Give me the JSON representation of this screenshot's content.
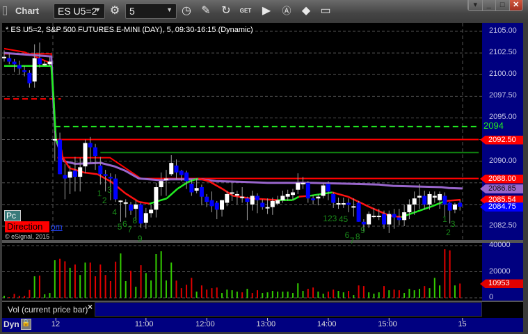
{
  "window": {
    "title": "Chart"
  },
  "toolbar": {
    "symbol": "ES U5=2",
    "interval": "5",
    "get_label": "GET"
  },
  "chart_info": "* ES U5=2, S&P 500 FUTURES E-MINI (DAY), 5, 09:30-16:15 (Dynamic)",
  "overlay": {
    "pc_label": "Pc",
    "direction_label": "Direction",
    "link_label": "om",
    "copyright": "© eSignal, 2015"
  },
  "vol_label": "Vol (current price bar)",
  "vol_close": "×",
  "bottom": {
    "dyn_label": "Dyn"
  },
  "colors": {
    "up": "#ffffff",
    "down": "#0000ff",
    "wick": "#a0a0a0",
    "vol_up": "#33cc00",
    "vol_down": "#e00000",
    "ma_up": "#22ee22",
    "ma_down": "#ff1111",
    "slow_ma": "#9966cc",
    "level_red": "#ff0000",
    "level_green": "#22ee22",
    "level_darkgreen": "#118811",
    "count": "#1a8a1a",
    "axis_bg": "#000080"
  },
  "chart_data": {
    "type": "candlestick",
    "ylim": [
      2081.5,
      2105.5
    ],
    "y_ticks": [
      "2105.00",
      "2102.50",
      "2100.00",
      "2097.50",
      "2095.00",
      "2090.00",
      "2082.50"
    ],
    "y_tick_values": [
      2105,
      2102.5,
      2100,
      2097.5,
      2095,
      2090,
      2082.5
    ],
    "x_ticks": [
      {
        "label": "12",
        "bar": 10.2
      },
      {
        "label": "11:00",
        "bar": 28
      },
      {
        "label": "12:00",
        "bar": 40
      },
      {
        "label": "13:00",
        "bar": 52
      },
      {
        "label": "14:00",
        "bar": 64
      },
      {
        "label": "15:00",
        "bar": 76
      },
      {
        "label": "15",
        "bar": 90.5
      }
    ],
    "candles": [
      [
        2102.0,
        2102.8,
        2101.5,
        2102.05
      ],
      [
        2101.9,
        2102.5,
        2101.2,
        2101.5
      ],
      [
        2101.5,
        2101.8,
        2100.3,
        2101.2
      ],
      [
        2101.1,
        2101.6,
        2100.0,
        2100.7
      ],
      [
        2100.5,
        2101.0,
        2099.8,
        2100.3
      ],
      [
        2100.2,
        2100.5,
        2098.5,
        2099.0
      ],
      [
        2099.2,
        2103.5,
        2098.5,
        2101.9
      ],
      [
        2101.9,
        2103.7,
        2100.8,
        2101.2
      ],
      [
        2101.2,
        2101.6,
        2101.0,
        2101.25
      ],
      [
        2101.2,
        2102.0,
        2101.0,
        2101.5
      ],
      [
        2092.5,
        2093.5,
        2090.0,
        2092.55
      ],
      [
        2092.5,
        2093.3,
        2088.5,
        2088.5
      ],
      [
        2088.4,
        2089.7,
        2085.6,
        2088.0
      ],
      [
        2088.1,
        2089.5,
        2086.2,
        2088.8
      ],
      [
        2088.9,
        2090.5,
        2086.5,
        2088.2
      ],
      [
        2088.2,
        2090.4,
        2086.5,
        2089.3
      ],
      [
        2089.4,
        2092.5,
        2088.6,
        2092.1
      ],
      [
        2092.1,
        2092.8,
        2089.8,
        2091.6
      ],
      [
        2091.6,
        2092.0,
        2089.0,
        2090.6
      ],
      [
        2089.5,
        2090.5,
        2087.3,
        2088.5
      ],
      [
        2088.5,
        2089.0,
        2086.5,
        2088.3
      ],
      [
        2088.2,
        2088.6,
        2085.5,
        2088.0
      ],
      [
        2088.0,
        2088.5,
        2085.3,
        2085.6
      ],
      [
        2085.4,
        2085.5,
        2083.0,
        2085.45
      ],
      [
        2085.2,
        2085.6,
        2083.5,
        2085.25
      ],
      [
        2085.0,
        2085.3,
        2083.8,
        2084.3
      ],
      [
        2084.5,
        2085.5,
        2083.2,
        2085.0
      ],
      [
        2085.0,
        2085.2,
        2082.3,
        2082.8
      ],
      [
        2082.9,
        2084.6,
        2082.2,
        2084.0
      ],
      [
        2084.0,
        2085.0,
        2083.5,
        2084.4
      ],
      [
        2084.4,
        2087.5,
        2083.5,
        2087.0
      ],
      [
        2087.0,
        2088.7,
        2086.0,
        2087.7
      ],
      [
        2087.9,
        2089.0,
        2086.0,
        2088.0
      ],
      [
        2088.5,
        2090.7,
        2088.3,
        2089.8
      ],
      [
        2089.5,
        2090.2,
        2087.9,
        2088.7
      ],
      [
        2088.9,
        2089.0,
        2087.7,
        2088.4
      ],
      [
        2088.7,
        2088.9,
        2086.8,
        2087.7
      ],
      [
        2087.4,
        2087.9,
        2086.0,
        2086.4
      ],
      [
        2086.6,
        2088.0,
        2086.3,
        2086.9
      ],
      [
        2087.0,
        2087.3,
        2084.9,
        2085.9
      ],
      [
        2085.9,
        2086.2,
        2084.7,
        2085.3
      ],
      [
        2085.5,
        2086.5,
        2084.1,
        2084.8
      ],
      [
        2085.2,
        2085.4,
        2083.3,
        2084.4
      ],
      [
        2084.4,
        2085.5,
        2083.6,
        2085.5
      ],
      [
        2085.2,
        2086.6,
        2084.8,
        2086.2
      ],
      [
        2086.35,
        2087.5,
        2085.4,
        2086.4
      ],
      [
        2086.15,
        2086.6,
        2085.0,
        2086.2
      ],
      [
        2085.85,
        2087.0,
        2085.2,
        2085.9
      ],
      [
        2085.7,
        2085.9,
        2083.2,
        2085.3
      ],
      [
        2085.0,
        2086.6,
        2084.3,
        2086.0
      ],
      [
        2086.0,
        2086.3,
        2084.0,
        2085.5
      ],
      [
        2085.2,
        2085.6,
        2084.4,
        2084.7
      ],
      [
        2084.65,
        2085.7,
        2083.9,
        2084.7
      ],
      [
        2084.7,
        2085.8,
        2083.8,
        2085.4
      ],
      [
        2085.1,
        2086.0,
        2084.9,
        2085.5
      ],
      [
        2085.5,
        2086.6,
        2085.2,
        2086.0
      ],
      [
        2085.9,
        2086.7,
        2085.4,
        2086.2
      ],
      [
        2086.1,
        2086.8,
        2085.5,
        2086.4
      ],
      [
        2086.7,
        2088.6,
        2086.2,
        2087.5
      ],
      [
        2087.45,
        2088.2,
        2086.8,
        2087.5
      ],
      [
        2087.5,
        2087.7,
        2085.2,
        2085.7
      ],
      [
        2085.7,
        2086.1,
        2085.0,
        2085.5
      ],
      [
        2085.7,
        2086.2,
        2084.9,
        2085.9
      ],
      [
        2086.0,
        2087.5,
        2085.7,
        2087.2
      ],
      [
        2087.4,
        2087.7,
        2085.5,
        2086.5
      ],
      [
        2086.2,
        2086.4,
        2084.6,
        2085.2
      ],
      [
        2085.1,
        2085.8,
        2084.5,
        2085.15
      ],
      [
        2085.1,
        2085.8,
        2084.6,
        2085.15
      ],
      [
        2085.2,
        2085.7,
        2084.1,
        2084.95
      ],
      [
        2084.75,
        2085.7,
        2083.6,
        2084.8
      ],
      [
        2085.2,
        2085.4,
        2083.0,
        2083.0
      ],
      [
        2083.0,
        2083.3,
        2081.9,
        2082.7
      ],
      [
        2082.7,
        2084.2,
        2082.3,
        2083.9
      ],
      [
        2083.65,
        2084.6,
        2083.4,
        2083.7
      ],
      [
        2083.65,
        2084.5,
        2083.2,
        2083.7
      ],
      [
        2083.9,
        2084.3,
        2082.2,
        2082.7
      ],
      [
        2082.7,
        2084.3,
        2081.7,
        2083.9
      ],
      [
        2083.9,
        2084.5,
        2082.2,
        2083.5
      ],
      [
        2083.5,
        2084.5,
        2082.6,
        2083.2
      ],
      [
        2083.2,
        2085.0,
        2082.5,
        2084.1
      ],
      [
        2084.1,
        2085.6,
        2083.3,
        2085.0
      ],
      [
        2085.0,
        2086.5,
        2083.8,
        2085.7
      ],
      [
        2085.8,
        2087.4,
        2084.5,
        2086.0
      ],
      [
        2086.0,
        2086.6,
        2084.4,
        2085.0
      ],
      [
        2085.0,
        2086.5,
        2084.4,
        2086.2
      ],
      [
        2085.8,
        2086.5,
        2085.2,
        2086.0
      ],
      [
        2085.5,
        2086.5,
        2084.5,
        2086.2
      ],
      [
        2086.0,
        2086.4,
        2083.6,
        2085.0
      ],
      [
        2085.2,
        2085.3,
        2082.8,
        2084.3
      ],
      [
        2084.4,
        2085.2,
        2084.0,
        2085.0
      ],
      [
        2085.2,
        2085.5,
        2084.3,
        2084.75
      ]
    ],
    "volume": [
      1600,
      500,
      3000,
      1600,
      1600,
      6000,
      16500,
      17000,
      2700,
      3700,
      28800,
      30000,
      28000,
      23000,
      25500,
      17500,
      27000,
      27000,
      16500,
      25500,
      17500,
      12800,
      27700,
      34000,
      12800,
      20800,
      8500,
      25000,
      19000,
      13300,
      33600,
      35700,
      13300,
      27000,
      13200,
      7400,
      10000,
      15300,
      4750,
      9500,
      6300,
      7400,
      7900,
      3700,
      6300,
      5800,
      4750,
      4200,
      6900,
      3700,
      5800,
      3700,
      4200,
      5300,
      4750,
      4750,
      4750,
      3700,
      11100,
      5300,
      6900,
      7900,
      4750,
      3200,
      4750,
      6300,
      5300,
      4200,
      5300,
      2100,
      9500,
      9000,
      4200,
      3200,
      4200,
      9000,
      5800,
      6300,
      5800,
      3700,
      6900,
      5800,
      6900,
      9000,
      7400,
      15300,
      9500,
      37300,
      36400,
      9500,
      10953
    ],
    "volume_dir": "gr rrrrgrggg rrgrggrrr rrrggrgrgg ggggrrrrgr rrrggggrgr rggggggggg rrggrrggrg rrgggrgrrg gggrgggrrgr",
    "volume_ylim": [
      0,
      40000
    ],
    "volume_ticks": [
      "40000",
      "20000",
      "0"
    ],
    "volume_tick_values": [
      40000,
      20000,
      0
    ],
    "colored_ma": [
      [
        0,
        2101.0,
        "u"
      ],
      [
        9.3,
        2101.0,
        "u"
      ],
      [
        9.8,
        2097,
        "u"
      ],
      [
        10.2,
        2092.5,
        "u"
      ],
      [
        11.3,
        2091.3,
        "d"
      ],
      [
        11.5,
        2090.5,
        "d"
      ],
      [
        12.9,
        2089.2,
        "d"
      ],
      [
        15.7,
        2088.7,
        "d"
      ],
      [
        18.4,
        2088.5,
        "d"
      ],
      [
        21.2,
        2087.6,
        "d"
      ],
      [
        23.9,
        2086.3,
        "d"
      ],
      [
        26.6,
        2085.3,
        "d"
      ],
      [
        28.7,
        2085.1,
        "u"
      ],
      [
        32.1,
        2085.7,
        "u"
      ],
      [
        34.2,
        2086.8,
        "u"
      ],
      [
        36.3,
        2087.6,
        "u"
      ],
      [
        38.3,
        2088.0,
        "d"
      ],
      [
        40.4,
        2087.7,
        "d"
      ],
      [
        43.1,
        2086.8,
        "d"
      ],
      [
        45.2,
        2086.0,
        "d"
      ],
      [
        48.6,
        2085.7,
        "d"
      ],
      [
        54.1,
        2085.5,
        "u"
      ],
      [
        56.9,
        2085.5,
        "u"
      ],
      [
        58.2,
        2085.9,
        "d"
      ],
      [
        60.3,
        2086.0,
        "u"
      ],
      [
        64.8,
        2086.4,
        "d"
      ],
      [
        67.9,
        2085.9,
        "d"
      ],
      [
        72,
        2084.75,
        "d"
      ],
      [
        76.1,
        2083.7,
        "d"
      ],
      [
        78.4,
        2083.55,
        "u"
      ],
      [
        81.6,
        2084.2,
        "u"
      ],
      [
        84.3,
        2084.75,
        "u"
      ],
      [
        87.1,
        2085.4,
        "d"
      ],
      [
        90.1,
        2085.54,
        "d"
      ]
    ],
    "slow_ma": [
      [
        0,
        2102.5
      ],
      [
        9.3,
        2102.1
      ],
      [
        9.8,
        2096
      ],
      [
        10.2,
        2092.5
      ],
      [
        11.8,
        2090.0
      ],
      [
        14,
        2089.7
      ],
      [
        19.1,
        2089.8
      ],
      [
        21.8,
        2089.4
      ],
      [
        23.9,
        2088.9
      ],
      [
        26.6,
        2088.0
      ],
      [
        30.8,
        2087.8
      ],
      [
        32.8,
        2087.9
      ],
      [
        39,
        2087.9
      ],
      [
        41.8,
        2087.7
      ],
      [
        47.2,
        2087.6
      ],
      [
        52,
        2087.5
      ],
      [
        60.6,
        2087.5
      ],
      [
        67.9,
        2087.4
      ],
      [
        74,
        2087.3
      ],
      [
        76.8,
        2087.15
      ],
      [
        86.4,
        2087.0
      ],
      [
        87.8,
        2086.9
      ],
      [
        90.5,
        2086.85
      ]
    ],
    "pivot_line": [
      [
        10.5,
        2090.4
      ],
      [
        20.9,
        2090.4
      ],
      [
        27,
        2088.0
      ],
      [
        93.7,
        2088.0
      ]
    ],
    "prev_day_lines": {
      "red_flat": [
        [
          0,
          2102.4
        ],
        [
          9.3,
          2102.4
        ],
        [
          9.3,
          2101.0
        ]
      ],
      "red_curve": [
        [
          0,
          2103.0
        ],
        [
          4,
          2102.6
        ],
        [
          9.3,
          2101.3
        ],
        [
          9.8,
          2097
        ],
        [
          10.2,
          2092.5
        ]
      ]
    },
    "levels": [
      {
        "price": 2097.2,
        "style": "dashed",
        "color": "red",
        "from": 0,
        "to": 11.2
      },
      {
        "price": 2094.0,
        "style": "dashed",
        "color": "green",
        "from": 10,
        "to": 93.7,
        "label": "2094"
      },
      {
        "price": 2092.5,
        "style": "solid",
        "color": "red",
        "from": 10,
        "to": 93.7
      },
      {
        "price": 2091.0,
        "style": "solid",
        "color": "darkgreen",
        "from": 19,
        "to": 93.7
      }
    ],
    "counts": [
      [
        "1",
        18.9,
        2086.2
      ],
      [
        "2",
        19.9,
        2085.4
      ],
      [
        "3",
        20.9,
        2086.6
      ],
      [
        "4",
        21.9,
        2084.0
      ],
      [
        "5",
        22.9,
        2082.3
      ],
      [
        "6",
        23.9,
        2082.7
      ],
      [
        "7",
        24.9,
        2082.0
      ],
      [
        "8",
        25.9,
        2083.1
      ],
      [
        "9",
        26.9,
        2081.0
      ],
      [
        "123",
        63.5,
        2083.3
      ],
      [
        "45",
        66.6,
        2083.2
      ],
      [
        "6",
        67.8,
        2081.4
      ],
      [
        "7",
        68.8,
        2080.7
      ],
      [
        "8",
        69.9,
        2081.2
      ],
      [
        "9",
        70.9,
        2081.9
      ],
      [
        "1",
        87.1,
        2083.2
      ],
      [
        "3",
        88.7,
        2082.7
      ],
      [
        "2",
        87.8,
        2081.7
      ]
    ],
    "price_tags": [
      {
        "label": "2092.50",
        "price": 2092.5,
        "kind": "red"
      },
      {
        "label": "2088.00",
        "price": 2088.0,
        "kind": "red"
      },
      {
        "label": "2086.85",
        "price": 2086.85,
        "kind": "purple"
      },
      {
        "label": "2085.54",
        "price": 2085.54,
        "kind": "red"
      },
      {
        "label": "2084.75",
        "price": 2084.75,
        "kind": "blue"
      }
    ],
    "volume_tag": {
      "label": "10953",
      "value": 10953
    }
  }
}
